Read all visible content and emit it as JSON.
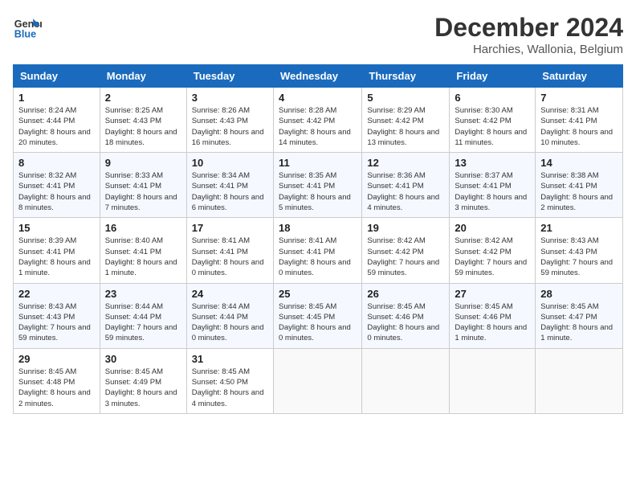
{
  "header": {
    "logo_line1": "General",
    "logo_line2": "Blue",
    "month_title": "December 2024",
    "location": "Harchies, Wallonia, Belgium"
  },
  "days_of_week": [
    "Sunday",
    "Monday",
    "Tuesday",
    "Wednesday",
    "Thursday",
    "Friday",
    "Saturday"
  ],
  "weeks": [
    [
      {
        "day": "1",
        "sunrise": "8:24 AM",
        "sunset": "4:44 PM",
        "daylight": "8 hours and 20 minutes."
      },
      {
        "day": "2",
        "sunrise": "8:25 AM",
        "sunset": "4:43 PM",
        "daylight": "8 hours and 18 minutes."
      },
      {
        "day": "3",
        "sunrise": "8:26 AM",
        "sunset": "4:43 PM",
        "daylight": "8 hours and 16 minutes."
      },
      {
        "day": "4",
        "sunrise": "8:28 AM",
        "sunset": "4:42 PM",
        "daylight": "8 hours and 14 minutes."
      },
      {
        "day": "5",
        "sunrise": "8:29 AM",
        "sunset": "4:42 PM",
        "daylight": "8 hours and 13 minutes."
      },
      {
        "day": "6",
        "sunrise": "8:30 AM",
        "sunset": "4:42 PM",
        "daylight": "8 hours and 11 minutes."
      },
      {
        "day": "7",
        "sunrise": "8:31 AM",
        "sunset": "4:41 PM",
        "daylight": "8 hours and 10 minutes."
      }
    ],
    [
      {
        "day": "8",
        "sunrise": "8:32 AM",
        "sunset": "4:41 PM",
        "daylight": "8 hours and 8 minutes."
      },
      {
        "day": "9",
        "sunrise": "8:33 AM",
        "sunset": "4:41 PM",
        "daylight": "8 hours and 7 minutes."
      },
      {
        "day": "10",
        "sunrise": "8:34 AM",
        "sunset": "4:41 PM",
        "daylight": "8 hours and 6 minutes."
      },
      {
        "day": "11",
        "sunrise": "8:35 AM",
        "sunset": "4:41 PM",
        "daylight": "8 hours and 5 minutes."
      },
      {
        "day": "12",
        "sunrise": "8:36 AM",
        "sunset": "4:41 PM",
        "daylight": "8 hours and 4 minutes."
      },
      {
        "day": "13",
        "sunrise": "8:37 AM",
        "sunset": "4:41 PM",
        "daylight": "8 hours and 3 minutes."
      },
      {
        "day": "14",
        "sunrise": "8:38 AM",
        "sunset": "4:41 PM",
        "daylight": "8 hours and 2 minutes."
      }
    ],
    [
      {
        "day": "15",
        "sunrise": "8:39 AM",
        "sunset": "4:41 PM",
        "daylight": "8 hours and 1 minute."
      },
      {
        "day": "16",
        "sunrise": "8:40 AM",
        "sunset": "4:41 PM",
        "daylight": "8 hours and 1 minute."
      },
      {
        "day": "17",
        "sunrise": "8:41 AM",
        "sunset": "4:41 PM",
        "daylight": "8 hours and 0 minutes."
      },
      {
        "day": "18",
        "sunrise": "8:41 AM",
        "sunset": "4:41 PM",
        "daylight": "8 hours and 0 minutes."
      },
      {
        "day": "19",
        "sunrise": "8:42 AM",
        "sunset": "4:42 PM",
        "daylight": "7 hours and 59 minutes."
      },
      {
        "day": "20",
        "sunrise": "8:42 AM",
        "sunset": "4:42 PM",
        "daylight": "7 hours and 59 minutes."
      },
      {
        "day": "21",
        "sunrise": "8:43 AM",
        "sunset": "4:43 PM",
        "daylight": "7 hours and 59 minutes."
      }
    ],
    [
      {
        "day": "22",
        "sunrise": "8:43 AM",
        "sunset": "4:43 PM",
        "daylight": "7 hours and 59 minutes."
      },
      {
        "day": "23",
        "sunrise": "8:44 AM",
        "sunset": "4:44 PM",
        "daylight": "7 hours and 59 minutes."
      },
      {
        "day": "24",
        "sunrise": "8:44 AM",
        "sunset": "4:44 PM",
        "daylight": "8 hours and 0 minutes."
      },
      {
        "day": "25",
        "sunrise": "8:45 AM",
        "sunset": "4:45 PM",
        "daylight": "8 hours and 0 minutes."
      },
      {
        "day": "26",
        "sunrise": "8:45 AM",
        "sunset": "4:46 PM",
        "daylight": "8 hours and 0 minutes."
      },
      {
        "day": "27",
        "sunrise": "8:45 AM",
        "sunset": "4:46 PM",
        "daylight": "8 hours and 1 minute."
      },
      {
        "day": "28",
        "sunrise": "8:45 AM",
        "sunset": "4:47 PM",
        "daylight": "8 hours and 1 minute."
      }
    ],
    [
      {
        "day": "29",
        "sunrise": "8:45 AM",
        "sunset": "4:48 PM",
        "daylight": "8 hours and 2 minutes."
      },
      {
        "day": "30",
        "sunrise": "8:45 AM",
        "sunset": "4:49 PM",
        "daylight": "8 hours and 3 minutes."
      },
      {
        "day": "31",
        "sunrise": "8:45 AM",
        "sunset": "4:50 PM",
        "daylight": "8 hours and 4 minutes."
      },
      null,
      null,
      null,
      null
    ]
  ],
  "labels": {
    "sunrise": "Sunrise:",
    "sunset": "Sunset:",
    "daylight": "Daylight:"
  },
  "colors": {
    "header_bg": "#1a6bbd",
    "accent": "#1a6bbd"
  }
}
